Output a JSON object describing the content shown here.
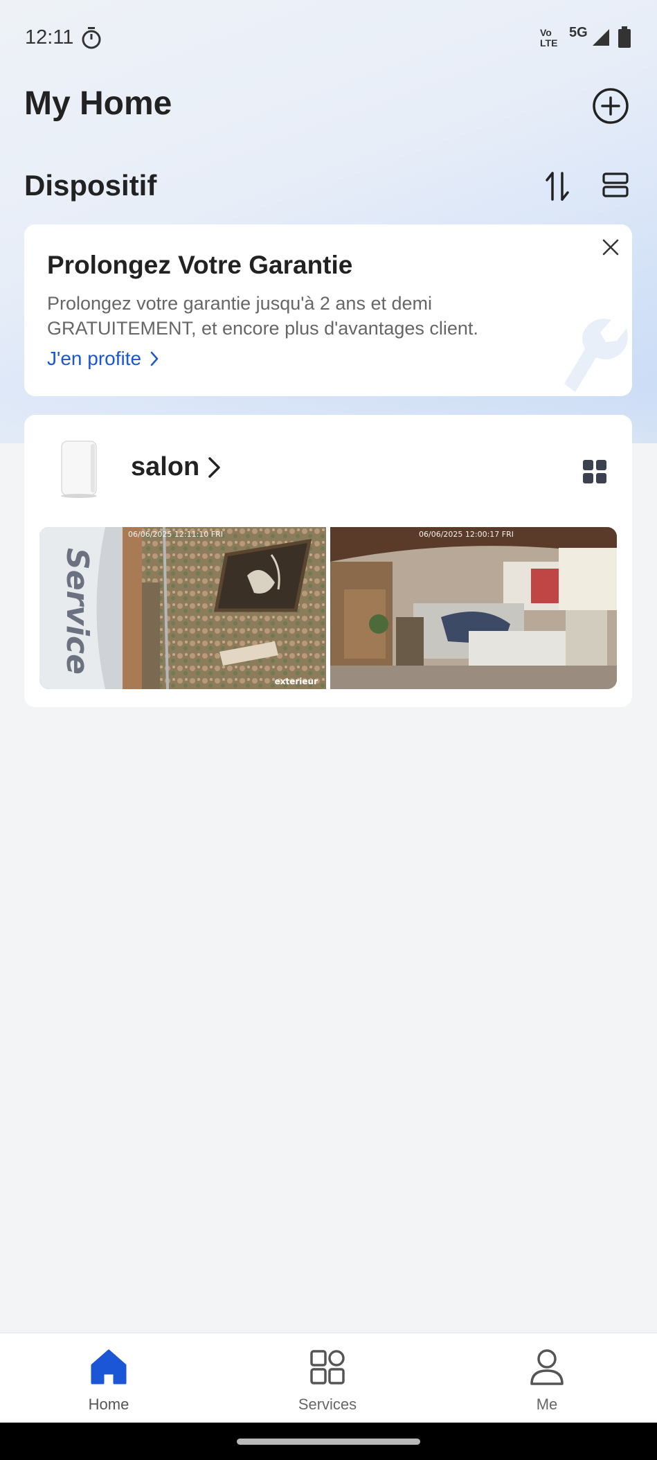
{
  "status_bar": {
    "time": "12:11",
    "volte_top": "Vo",
    "volte_bottom": "LTE",
    "network": "5G"
  },
  "header": {
    "title": "My Home"
  },
  "section": {
    "title": "Dispositif"
  },
  "promo": {
    "title": "Prolongez Votre Garantie",
    "text": "Prolongez votre garantie jusqu'à 2 ans et demi GRATUITEMENT,  et encore plus d'avantages client.",
    "link": "J'en profite"
  },
  "device": {
    "name": "salon",
    "cameras": [
      {
        "timestamp": "06/06/2025 12:11:10 FRI",
        "label": "exterieur"
      },
      {
        "timestamp": "06/06/2025 12:00:17 FRI",
        "label": ""
      }
    ]
  },
  "nav": {
    "items": [
      {
        "label": "Home"
      },
      {
        "label": "Services"
      },
      {
        "label": "Me"
      }
    ]
  },
  "colors": {
    "accent": "#1a56d6",
    "nav_active": "#1a56d6",
    "text_dark": "#222222",
    "text_muted": "#666666"
  }
}
